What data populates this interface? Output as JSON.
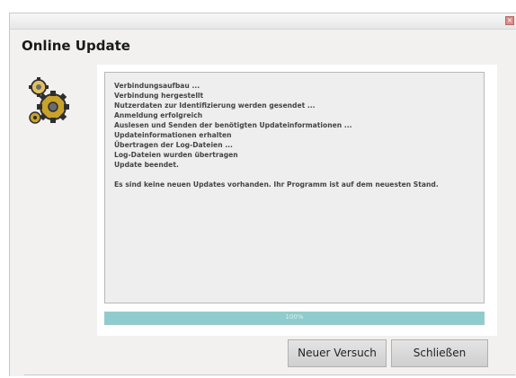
{
  "window": {
    "title": "Online Update",
    "close_glyph": "×"
  },
  "icon": {
    "name": "gears-icon",
    "colors": [
      "#c9a22a",
      "#6a6a6a",
      "#2e2e2e"
    ]
  },
  "log": {
    "lines": [
      "Verbindungsaufbau ...",
      "Verbindung hergestellt",
      "Nutzerdaten zur Identifizierung werden gesendet ...",
      "Anmeldung erfolgreich",
      "Auslesen und Senden der benötigten Updateinformationen ...",
      "Updateinformationen erhalten",
      "Übertragen der Log-Dateien ...",
      "Log-Dateien wurden übertragen",
      "Update beendet."
    ],
    "message": "Es sind keine neuen Updates vorhanden. Ihr Programm ist auf dem neuesten Stand."
  },
  "progress": {
    "value": 1.0,
    "label": "100%",
    "color": "#8fcccd"
  },
  "buttons": {
    "retry_label": "Neuer Versuch",
    "close_label": "Schließen"
  }
}
